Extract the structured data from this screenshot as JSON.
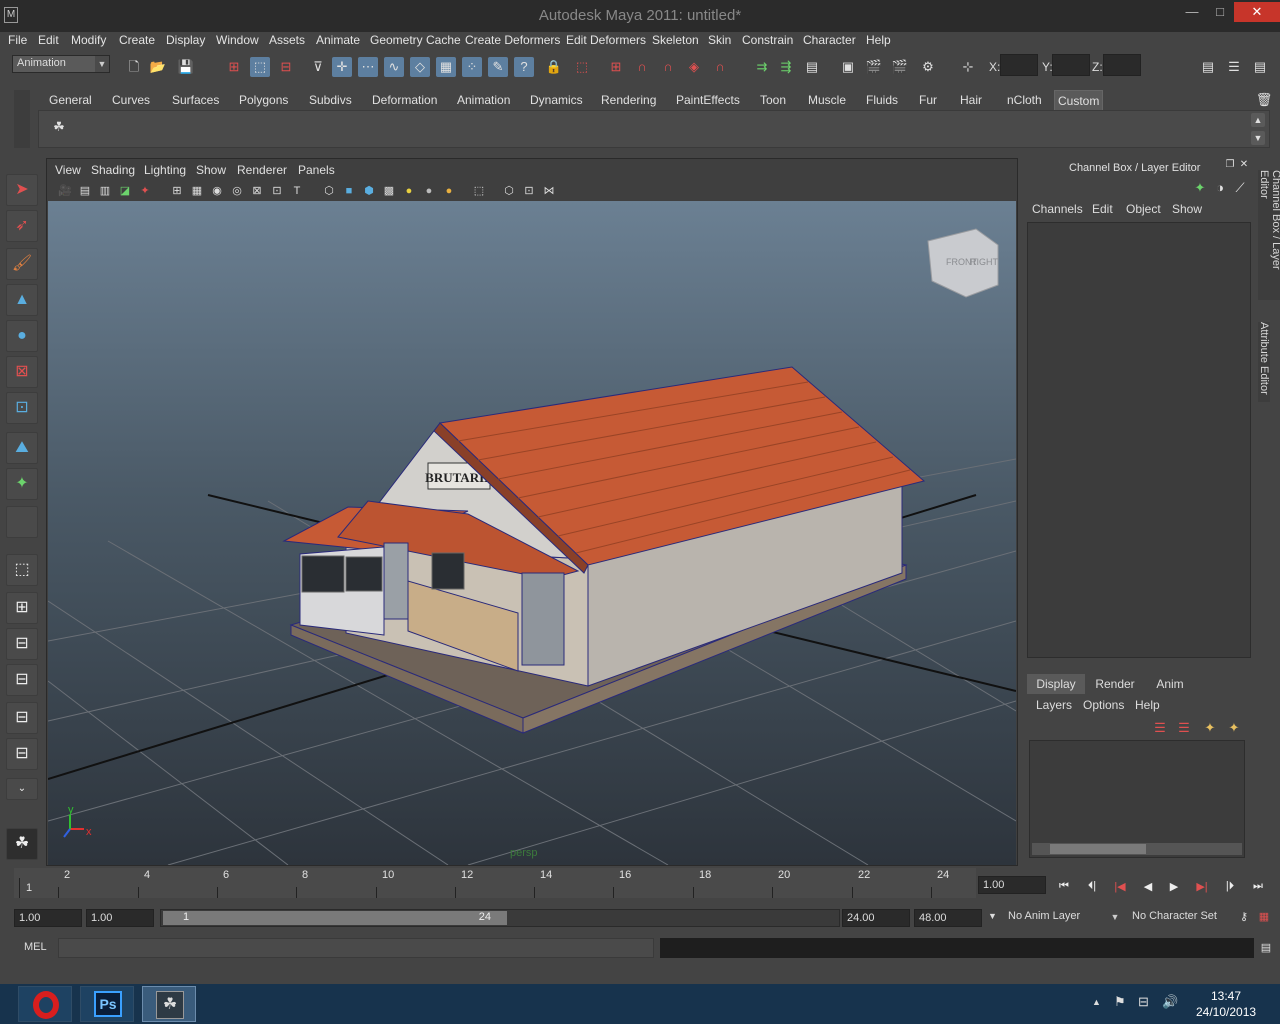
{
  "window": {
    "title": "Autodesk Maya 2011: untitled*",
    "logo": "M",
    "minimize": "—",
    "maximize": "□",
    "close": "✕"
  },
  "menubar": [
    "File",
    "Edit",
    "Modify",
    "Create",
    "Display",
    "Window",
    "Assets",
    "Animate",
    "Geometry Cache",
    "Create Deformers",
    "Edit Deformers",
    "Skeleton",
    "Skin",
    "Constrain",
    "Character",
    "Help"
  ],
  "toolbar": {
    "menuset": "Animation",
    "x_label": "X:",
    "y_label": "Y:",
    "z_label": "Z:"
  },
  "shelf_tabs": [
    "General",
    "Curves",
    "Surfaces",
    "Polygons",
    "Subdivs",
    "Deformation",
    "Animation",
    "Dynamics",
    "Rendering",
    "PaintEffects",
    "Toon",
    "Muscle",
    "Fluids",
    "Fur",
    "Hair",
    "nCloth",
    "Custom"
  ],
  "shelf_active": "Custom",
  "viewport": {
    "menu": [
      "View",
      "Shading",
      "Lighting",
      "Show",
      "Renderer",
      "Panels"
    ],
    "camera_label": "persp",
    "viewcube": {
      "front": "FRONT",
      "right": "RIGHT"
    },
    "sign_text": "BRUTARIE",
    "axis": {
      "x": "x",
      "y": "y"
    }
  },
  "channel_box": {
    "title": "Channel Box / Layer Editor",
    "menu": [
      "Channels",
      "Edit",
      "Object",
      "Show"
    ],
    "layer_tabs": [
      "Display",
      "Render",
      "Anim"
    ],
    "layer_tab_active": "Display",
    "layer_menu": [
      "Layers",
      "Options",
      "Help"
    ]
  },
  "side_tabs": {
    "channel": "Channel Box / Layer Editor",
    "attribute": "Attribute Editor"
  },
  "timeline": {
    "start_marker": "1",
    "ticks": [
      "2",
      "4",
      "6",
      "8",
      "10",
      "12",
      "14",
      "16",
      "18",
      "20",
      "22",
      "24"
    ],
    "current_time": "1.00"
  },
  "range": {
    "start": "1.00",
    "anim_start": "1.00",
    "slider_start": "1",
    "slider_end": "24",
    "end": "24.00",
    "anim_end": "48.00",
    "anim_layer": "No Anim Layer",
    "character_set": "No Character Set"
  },
  "command_line": {
    "label": "MEL"
  },
  "taskbar": {
    "clock_time": "13:47",
    "clock_date": "24/10/2013",
    "ps_label": "Ps"
  },
  "colors": {
    "accent_close": "#c7352a",
    "roof": "#c65a35",
    "taskbar": "#17334d"
  }
}
